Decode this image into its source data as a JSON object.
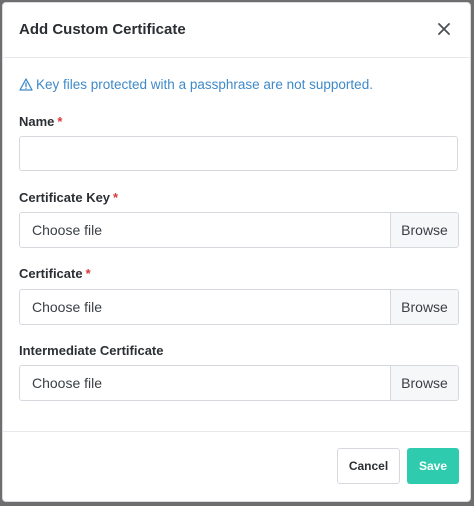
{
  "dialog": {
    "title": "Add Custom Certificate",
    "close_label": "×"
  },
  "warning": {
    "text": "Key files protected with a passphrase are not supported.",
    "color": "#3f89c9"
  },
  "fields": {
    "name": {
      "label": "Name",
      "required_mark": "*",
      "value": ""
    },
    "certificate_key": {
      "label": "Certificate Key",
      "required_mark": "*",
      "file_text": "Choose file",
      "browse_label": "Browse"
    },
    "certificate": {
      "label": "Certificate",
      "required_mark": "*",
      "file_text": "Choose file",
      "browse_label": "Browse"
    },
    "intermediate_certificate": {
      "label": "Intermediate Certificate",
      "file_text": "Choose file",
      "browse_label": "Browse"
    }
  },
  "footer": {
    "cancel_label": "Cancel",
    "save_label": "Save",
    "save_color": "#2fcbae"
  },
  "colors": {
    "required": "#d63939"
  }
}
